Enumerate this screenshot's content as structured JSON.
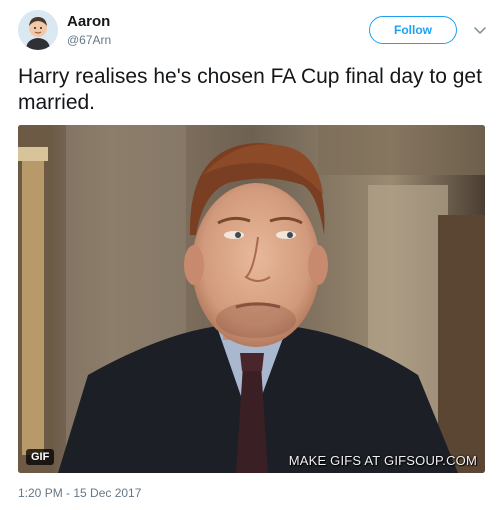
{
  "author": {
    "name": "Aaron",
    "handle": "@67Arn",
    "avatar_icon": "cartoon-avatar-icon"
  },
  "follow_button": {
    "label": "Follow"
  },
  "tweet": {
    "text": "Harry realises he's chosen FA Cup final day to get married."
  },
  "media": {
    "badge": "GIF",
    "watermark": "MAKE GIFS AT GIFSOUP.COM"
  },
  "timestamp": "1:20 PM - 15 Dec 2017",
  "colors": {
    "accent": "#1da1f2",
    "text": "#14171a",
    "muted": "#657786"
  }
}
